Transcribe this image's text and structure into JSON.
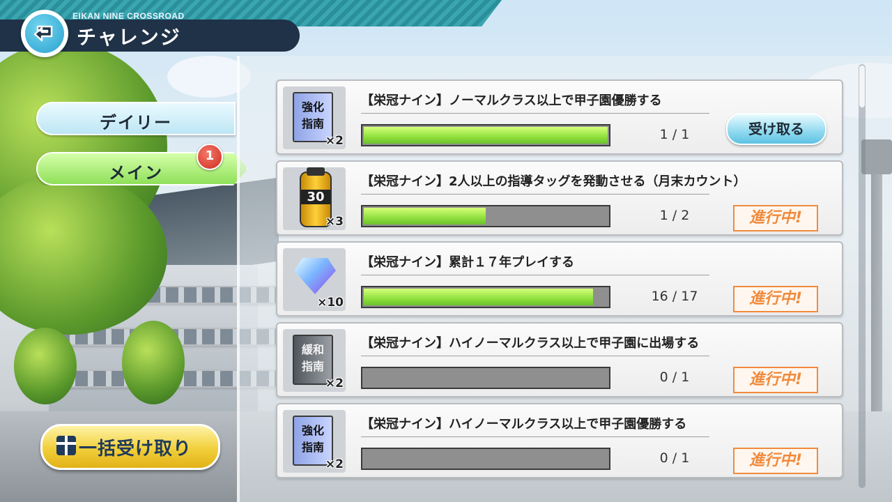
{
  "header": {
    "subtitle": "EIKAN NINE CROSSROAD",
    "title": "チャレンジ"
  },
  "tabs": {
    "daily": "デイリー",
    "main": "メイン",
    "main_badge": "1"
  },
  "bulk_button": "一括受け取り",
  "colors": {
    "progress_fill": "#8fe03e",
    "status_orange": "#f08a3c",
    "header_dark": "#1f3247"
  },
  "challenges": [
    {
      "icon": "book-kyouka-shinan",
      "icon_text": "強化\n指南",
      "qty": "×2",
      "title": "【栄冠ナイン】ノーマルクラス以上で甲子園優勝する",
      "progress": 1.0,
      "count": "1 / 1",
      "action": "受け取る"
    },
    {
      "icon": "energy-bottle-30",
      "icon_text": "30",
      "qty": "×3",
      "title": "【栄冠ナイン】2人以上の指導タッグを発動させる（月末カウント）",
      "progress": 0.5,
      "count": "1 / 2",
      "status": "進行中!"
    },
    {
      "icon": "diamond-gem",
      "qty": "×10",
      "title": "【栄冠ナイン】累計１７年プレイする",
      "progress": 0.94,
      "count": "16 / 17",
      "status": "進行中!"
    },
    {
      "icon": "book-kanwa-shinan",
      "icon_text": "緩和\n指南",
      "qty": "×2",
      "title": "【栄冠ナイン】ハイノーマルクラス以上で甲子園に出場する",
      "progress": 0.0,
      "count": "0 / 1",
      "status": "進行中!"
    },
    {
      "icon": "book-kyouka-shinan",
      "icon_text": "強化\n指南",
      "qty": "×2",
      "title": "【栄冠ナイン】ハイノーマルクラス以上で甲子園優勝する",
      "progress": 0.0,
      "count": "0 / 1",
      "status": "進行中!"
    }
  ]
}
